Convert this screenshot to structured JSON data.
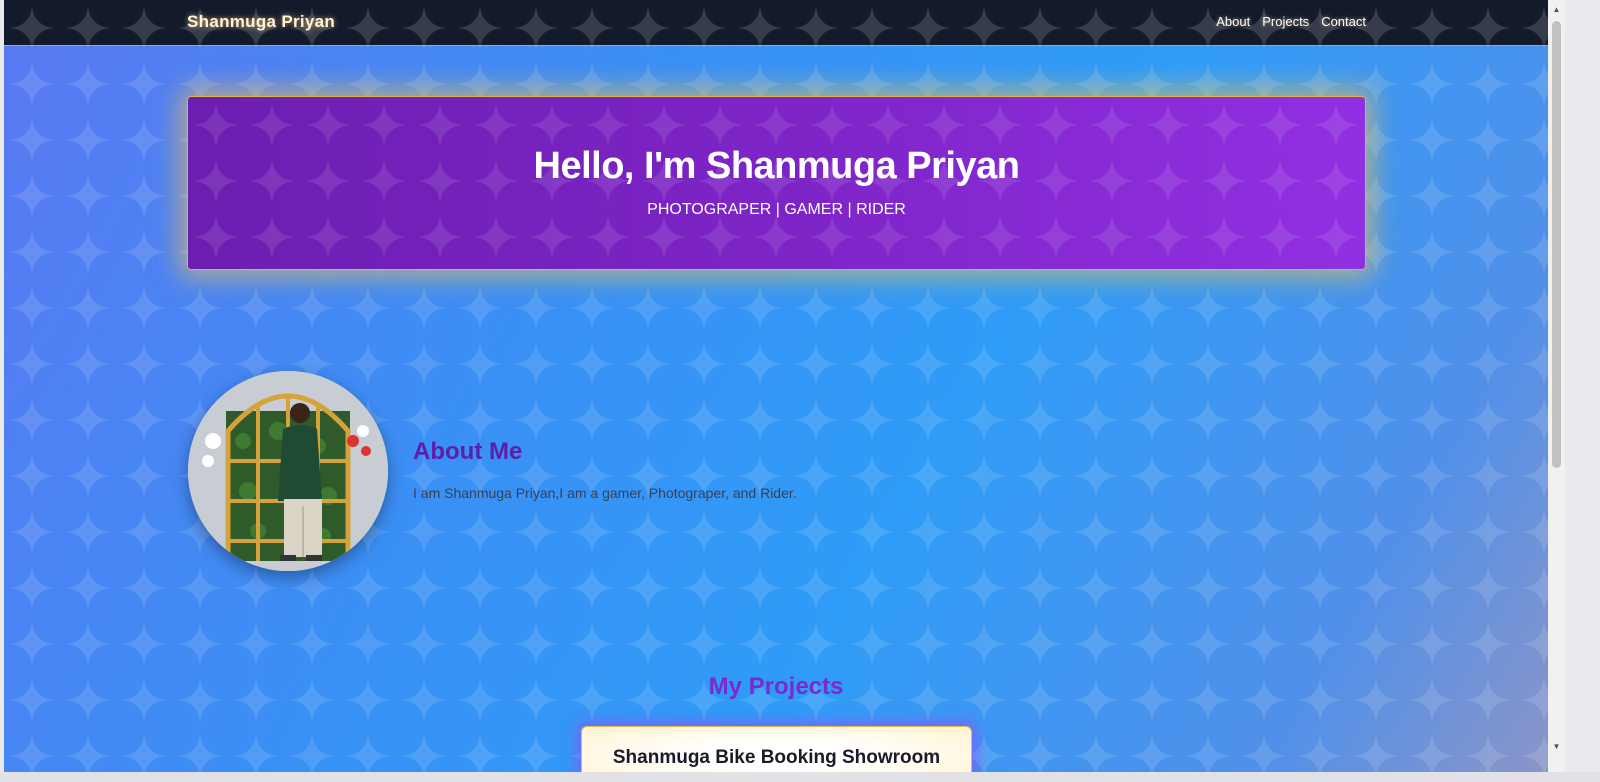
{
  "header": {
    "brand": "Shanmuga Priyan",
    "nav": [
      {
        "label": "About"
      },
      {
        "label": "Projects"
      },
      {
        "label": "Contact"
      }
    ]
  },
  "hero": {
    "title": "Hello, I'm Shanmuga Priyan",
    "subtitle": "PHOTOGRAPER | GAMER | RIDER"
  },
  "about": {
    "title": "About Me",
    "text": "I am Shanmuga Priyan,I am a gamer, Photograper, and Rider.",
    "avatar_icon": "profile-photo"
  },
  "projects": {
    "title": "My Projects",
    "items": [
      {
        "title": "Shanmuga Bike Booking Showroom"
      }
    ]
  },
  "colors": {
    "header_bg": "#121a2c",
    "hero_gradient_start": "#6c1eb0",
    "hero_gradient_end": "#9130e2",
    "hero_glow": "#ffc846",
    "about_title": "#5b1fa8",
    "projects_title": "#7a2bd0"
  }
}
